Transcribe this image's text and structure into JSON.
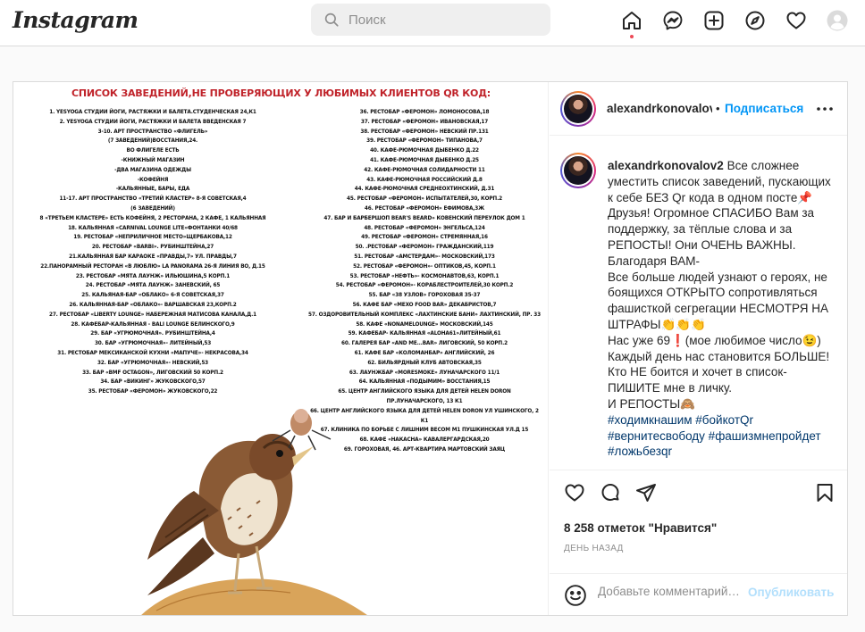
{
  "nav": {
    "logo": "Instagram",
    "search_placeholder": "Поиск",
    "icons": [
      "home-icon",
      "messenger-icon",
      "new-post-icon",
      "explore-icon",
      "activity-heart-icon",
      "profile-avatar-icon"
    ]
  },
  "post": {
    "header": {
      "username": "alexandrkonovalov",
      "follow_label": "Подписаться",
      "separator": "•"
    },
    "image": {
      "title": "СПИСОК ЗАВЕДЕНИЙ,НЕ ПРОВЕРЯЮЩИХ У ЛЮБИМЫХ КЛИЕНТОВ QR КОД:",
      "left_list": "1. YESYOGA СТУДИИ ЙОГИ, РАСТЯЖКИ И БАЛЕТА.СТУДЕНЧЕСКАЯ 24,К1\n2. YESYOGA СТУДИИ ЙОГИ, РАСТЯЖКИ И БАЛЕТА ВВЕДЕНСКАЯ 7\n3-10. АРТ ПРОСТРАНСТВО «ФЛИГЕЛЬ»\n(7 ЗАВЕДЕНИЙ)ВОССТАНИЯ,24.\nВО ФЛИГЕЛЕ ЕСТЬ\n-КНИЖНЫЙ МАГАЗИН\n-ДВА МАГАЗИНА ОДЕЖДЫ\n-КОФЕЙНЯ\n-КАЛЬЯННЫЕ, БАРЫ, ЕДА\n11-17. АРТ ПРОСТРАНСТВО «ТРЕТИЙ КЛАСТЕР» 8-Я СОВЕТСКАЯ,4\n(6 ЗАВЕДЕНИЙ)\n8 «ТРЕТЬЕМ КЛАСТЕРЕ» ЕСТЬ КОФЕЙНЯ, 2 РЕСТОРАНА, 2 КАФЕ, 1 КАЛЬЯННАЯ\n18. КАЛЬЯННАЯ «CARNIVAL LOUNGE LITE»ФОНТАНКИ 40/68\n19. РЕСТОБАР «НЕПРИЛИЧНОЕ МЕСТО»ЩЕРБАКОВА,12\n20. РЕСТОБАР «BARBI». РУБИНШТЕЙНА,27\n21.КАЛЬЯННАЯ БАР КАРАОКЕ «ПРАВДЫ,7» УЛ. ПРАВДЫ,7\n22.ПАНОРАМНЫЙ РЕСТОРАН «В ЛЮБЛЮ» LA PANORAMA 26-Я ЛИНИЯ ВО, Д.15\n23. РЕСТОБАР «МЯТА ЛАУНЖ» ИЛЬЮШИНА,5 КОРП.1\n24. РЕСТОБАР «МЯТА ЛАУНЖ» ЗАНЕВСКИЙ, 65\n25. КАЛЬЯНАЯ-БАР «ОБЛАКО» 6-Я СОВЕТСКАЯ,37\n26. КАЛЬЯННАЯ-БАР «ОБЛАКО»- ВАРШАВСКАЯ 23,КОРП.2\n27. РЕСТОБАР «LIBERTY LOUNGE» НАБЕРЕЖНАЯ МАТИСОВА КАНАЛА,Д.1\n28. КАФЕБАР-КАЛЬЯННАЯ - BALI LOUNGE БЕЛИНСКОГО,9\n29. БАР «УГРЮМОЧНАЯ». РУБИНШТЕЙНА,4\n30. БАР «УГРЮМОЧНАЯ»- ЛИТЕЙНЫЙ,53\n31. РЕСТОБАР МЕКСИКАНСКОЙ КУХНИ «МАПУЧЕ»- НЕКРАСОВА,34\n32. БАР «УГРЮМОЧНАЯ»- НЕВСКИЙ,53\n33. БАР «BMF OCTAGON», ЛИГОВСКИЙ 50 КОРП.2\n34. БАР «ВИКИНГ» ЖУКОВСКОГО,57\n35. РЕСТОБАР «ФЕРОМОН» ЖУКОВСКОГО,22",
      "right_list": "36. РЕСТОБАР «ФЕРОМОН» ЛОМОНОСОВА,18\n37. РЕСТОБАР «ФЕРОМОН» ИВАНОВСКАЯ,17\n38. РЕСТОБАР «ФЕРОМОН» НЕВСКИЙ ПР.131\n39. РЕСТОБАР «ФЕРОМОН» ТИПАНОВА,7\n40. КАФЕ-РЮМОЧНАЯ ДЫБЕНКО Д.22\n41. КАФЕ-РЮМОЧНАЯ ДЫБЕНКО Д.25\n42. КАФЕ-РЮМОЧНАЯ СОЛИДАРНОСТИ 11\n43. КАФЕ-РЮМОЧНАЯ РОССИЙСКИЙ Д.8\n44. КАФЕ-РЮМОЧНАЯ СРЕДНЕОХТИНСКИЙ, Д.31\n45. РЕСТОБАР «ФЕРОМОН» ИСПЫТАТЕЛЕЙ,30, КОРП.2\n46. РЕСТОБАР «ФЕРОМОН» ЕФИМОВА,3Ж\n47. БАР И БАРБЕРШОП BEAR'S BEARD» КОВЕНСКИЙ ПЕРЕУЛОК ДОМ 1\n48. РЕСТОБАР «ФЕРОМОН» ЭНГЕЛЬСА,124\n49. РЕСТОБАР «ФЕРОМОН» СТРЕМЯННАЯ,16\n50. .РЕСТОБАР «ФЕРОМОН» ГРАЖДАНСКИЙ,119\n51. РЕСТОБАР «АМСТЕРДАМ»- МОСКОВСКИЙ,173\n52. РЕСТОБАР «ФЕРОМОН»- ОПТИКОВ,45, КОРП.1\n53. РЕСТОБАР «НЕФТЬ»- КОСМОНАВТОВ,63, КОРП.1\n54. РЕСТОБАР «ФЕРОМОН»- КОРАБЛЕСТРОИТЕЛЕЙ,30 КОРП.2\n55. БАР «38 УЗЛОВ» ГОРОХОВАЯ 35-37\n56. КАФЕ БАР «MEXO FOOD BAR» ДЕКАБРИСТОВ,7\n57. ОЗДОРОВИТЕЛЬНЫЙ КОМПЛЕКС «ЛАХТИНСКИЕ БАНИ» ЛАХТИНСКИЙ, ПР. 33\n58. КАФЕ «NONAMELOUNGE» МОСКОВСКИЙ,145\n59. КАФЕБАР- КАЛЬЯННАЯ «ALOHA61»ЛИТЕЙНЫЙ,61\n60. ГАЛЕРЕЯ БАР «AND ME...BAR» ЛИГОВСКИЙ, 50 КОРП.2\n61. КАФЕ БАР «КОЛОМАНБАР» АНГЛИЙСКИЙ, 26\n62. БИЛЬЯРДНЫЙ КЛУБ АВТОВСКАЯ,35\n63. ЛАУНЖБАР «MORESMOKE» ЛУНАЧАРСКОГО 11/1\n64. КАЛЬЯННАЯ «ПОДЫМИМ» ВОССТАНИЯ,15\n65. ЦЕНТР АНГЛИЙСКОГО ЯЗЫКА ДЛЯ ДЕТЕЙ HELEN DORON ПР.ЛУНАЧАРСКОГО, 13 К1\n66. ЦЕНТР АНГЛИЙСКОГО ЯЗЫКА ДЛЯ ДЕТЕЙ HELEN DORON УЛ УШИНСКОГО, 2 К1\n67. КЛИНИКА ПО БОРЬБЕ С ЛИШНИМ ВЕСОМ M1 ПУШКИНСКАЯ УЛ.Д 15\n68. КАФЕ «НАКАСНА» КАВАЛЕРГАРДСКАЯ,20\n69. ГОРОХОВАЯ, 46. АРТ-КВАРТИРА МАРТОВСКИЙ ЗАЯЦ"
    },
    "caption": {
      "username": "alexandrkonovalov2",
      "text": " Все сложнее уместить список заведений, пускающих к себе БЕЗ Qr кода в одном посте📌\nДрузья! Огромное СПАСИБО Вам за поддержку, за тёплые слова и за РЕПОСТЫ! Они ОЧЕНЬ ВАЖНЫ. Благодаря ВАМ-\nВсе больше людей узнают о героях, не боящихся ОТКРЫТО сопротивляться фашисткой сегрегации НЕСМОТРЯ НА ШТРАФЫ👏👏👏\nНас уже 69❗(мое любимое число😉)\nКаждый день нас становится БОЛЬШЕ!\nКто НЕ боится и хочет в список-ПИШИТЕ мне в личку.\nИ РЕПОСТЫ🙈\n",
      "hashtags": "#ходимкнашим #бойкотQr #вернитесвободу #фашизмнепройдет #ложьбезqr"
    },
    "likes": "8 258 отметок \"Нравится\"",
    "time": "день назад",
    "comment_placeholder": "Добавьте комментарий…",
    "publish_label": "Опубликовать"
  }
}
